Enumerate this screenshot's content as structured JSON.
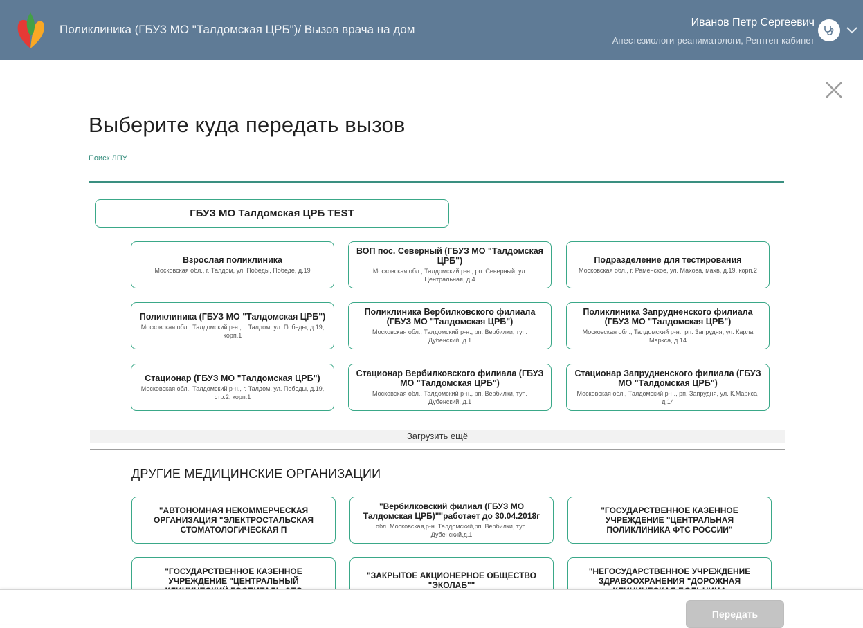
{
  "header": {
    "title": "Поликлиника (ГБУЗ МО \"Талдомская ЦРБ\")/ Вызов врача на дом",
    "user_name": "Иванов Петр Сергеевич",
    "user_dept": "Анестезиологи-реаниматологи, Рентген-кабинет"
  },
  "dialog": {
    "title": "Выберите куда передать вызов",
    "search_label": "Поиск ЛПУ",
    "search_value": ""
  },
  "main_org": {
    "name": "ГБУЗ МО Талдомская ЦРБ TEST"
  },
  "subdivisions": [
    {
      "name": "Взрослая поликлиника",
      "address": "Московская обл., г. Талдом, ул. Победы, Победе, д.19"
    },
    {
      "name": "ВОП пос. Северный (ГБУЗ МО \"Талдомская ЦРБ\")",
      "address": "Московская обл., Талдомский р-н., рп. Северный, ул. Центральная, д.4"
    },
    {
      "name": "Подразделение для тестирования",
      "address": "Московская обл., г. Раменское, ул. Махова, махв, д.19, корп.2"
    },
    {
      "name": "Поликлиника (ГБУЗ МО \"Талдомская ЦРБ\")",
      "address": "Московская обл., Талдомский р-н., г. Талдом, ул. Победы, д.19, корп.1"
    },
    {
      "name": "Поликлиника Вербилковского филиала (ГБУЗ МО \"Талдомская ЦРБ\")",
      "address": "Московская обл., Талдомский р-н., рп. Вербилки, туп. Дубенский, д.1"
    },
    {
      "name": "Поликлиника Запрудненского филиала (ГБУЗ МО \"Талдомская ЦРБ\")",
      "address": "Московская обл., Талдомский р-н., рп. Запрудня, ул. Карла Маркса, д.14"
    },
    {
      "name": "Стационар (ГБУЗ МО \"Талдомская ЦРБ\")",
      "address": "Московская обл., Талдомский р-н., г. Талдом, ул. Победы, д.19, стр.2, корп.1"
    },
    {
      "name": "Стационар Вербилковского филиала (ГБУЗ МО \"Талдомская ЦРБ\")",
      "address": "Московская обл., Талдомский р-н., рп. Вербилки, туп. Дубенский, д.1"
    },
    {
      "name": "Стационар Запрудненского филиала (ГБУЗ МО \"Талдомская ЦРБ\")",
      "address": "Московская обл., Талдомский р-н., рп. Запрудня, ул. К.Маркса, д.14"
    }
  ],
  "load_more_label": "Загрузить ещё",
  "other_section_title": "ДРУГИЕ МЕДИЦИНСКИЕ ОРГАНИЗАЦИИ",
  "other_orgs": [
    {
      "name": "\"АВТОНОМНАЯ НЕКОММЕРЧЕСКАЯ ОРГАНИЗАЦИЯ \"ЭЛЕКТРОСТАЛЬСКАЯ СТОМАТОЛОГИЧЕСКАЯ П",
      "address": ""
    },
    {
      "name": "\"Вербилковский филиал (ГБУЗ МО Талдомская ЦРБ)\"\"работает до 30.04.2018г",
      "address": "обл. Московская,р-н. Талдомский,рп. Вербилки, туп. Дубенский,д.1"
    },
    {
      "name": "\"ГОСУДАРСТВЕННОЕ КАЗЕННОЕ УЧРЕЖДЕНИЕ \"ЦЕНТРАЛЬНАЯ ПОЛИКЛИНИКА ФТС РОССИИ\"",
      "address": ""
    },
    {
      "name": "\"ГОСУДАРСТВЕННОЕ КАЗЕННОЕ УЧРЕЖДЕНИЕ \"ЦЕНТРАЛЬНЫЙ КЛИНИЧЕСКИЙ ГОСПИТАЛЬ ФТС",
      "address": ""
    },
    {
      "name": "\"ЗАКРЫТОЕ АКЦИОНЕРНОЕ ОБЩЕСТВО \"ЭКОЛАБ\"\"",
      "address": ""
    },
    {
      "name": "\"НЕГОСУДАРСТВЕННОЕ УЧРЕЖДЕНИЕ ЗДРАВООХРАНЕНИЯ \"ДОРОЖНАЯ КЛИНИЧЕСКАЯ БОЛЬНИЦА",
      "address": ""
    }
  ],
  "footer": {
    "submit_label": "Передать"
  },
  "colors": {
    "header_bg": "#5f7b96",
    "accent": "#3aa888",
    "button_disabled": "#c4c4c4"
  },
  "icons": {
    "logo": "heart-logo-icon",
    "avatar": "stethoscope-icon",
    "menu": "chevron-down-icon",
    "close": "close-icon"
  }
}
